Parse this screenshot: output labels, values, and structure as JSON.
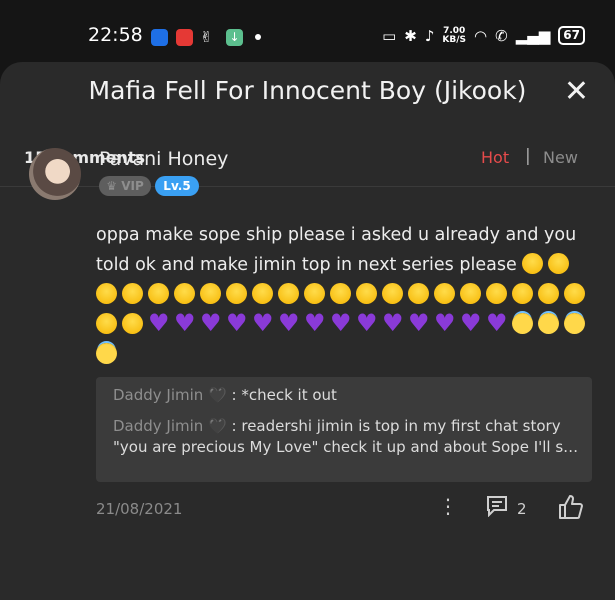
{
  "status_bar": {
    "time": "22:58",
    "net_speed_value": "7.00",
    "net_speed_unit": "KB/S",
    "battery": "67",
    "app_icon_colors": [
      "#1e6fe6",
      "#e53935",
      "#5cbf8e"
    ]
  },
  "sheet": {
    "title": "Mafia Fell For Innocent Boy (Jikook)",
    "comment_count": "15 comments",
    "tabs": {
      "hot": "Hot",
      "separator": "|",
      "new": "New"
    },
    "accent_color": "#e64b4b"
  },
  "comment": {
    "username": "Pavani Honey",
    "vip_label": "VIP",
    "level_label": "Lv.5",
    "text": "oppa make sope ship please i asked u already and you told ok and make jimin top in next series please",
    "emojis": {
      "pleading_count": 23,
      "purple_heart_count": 14,
      "halo_count": 4
    },
    "date": "21/08/2021",
    "reply_count": "2"
  },
  "replies": [
    {
      "author": "Daddy Jimin",
      "text": " : *check it out"
    },
    {
      "author": "Daddy Jimin",
      "text": " : readershi jimin is top in my first chat story \"you are precious My Love\" check it up and about Sope I'll s…"
    }
  ]
}
